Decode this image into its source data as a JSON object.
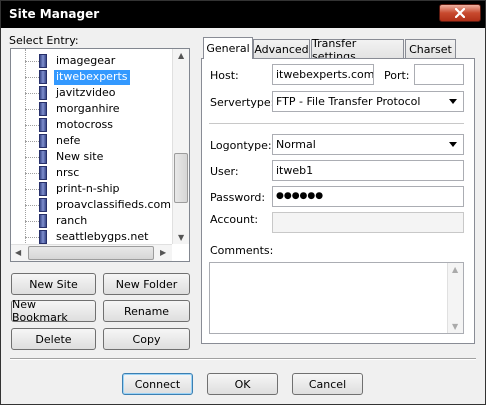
{
  "window": {
    "title": "Site Manager"
  },
  "left": {
    "select_entry_label": "Select Entry:",
    "entries": [
      {
        "label": "imagegear",
        "selected": false
      },
      {
        "label": "itwebexperts",
        "selected": true
      },
      {
        "label": "javitzvideo",
        "selected": false
      },
      {
        "label": "morganhire",
        "selected": false
      },
      {
        "label": "motocross",
        "selected": false
      },
      {
        "label": "nefe",
        "selected": false
      },
      {
        "label": "New site",
        "selected": false
      },
      {
        "label": "nrsc",
        "selected": false
      },
      {
        "label": "print-n-ship",
        "selected": false
      },
      {
        "label": "proavclassifieds.com",
        "selected": false
      },
      {
        "label": "ranch",
        "selected": false
      },
      {
        "label": "seattlebygps.net",
        "selected": false
      }
    ],
    "buttons": {
      "new_site": "New Site",
      "new_folder": "New Folder",
      "new_bookmark": "New Bookmark",
      "rename": "Rename",
      "delete": "Delete",
      "copy": "Copy"
    }
  },
  "tabs": [
    {
      "label": "General",
      "active": true
    },
    {
      "label": "Advanced",
      "active": false
    },
    {
      "label": "Transfer settings",
      "active": false
    },
    {
      "label": "Charset",
      "active": false
    }
  ],
  "general": {
    "host_label": "Host:",
    "host_value": "itwebexperts.com",
    "port_label": "Port:",
    "port_value": "",
    "servertype_label": "Servertype:",
    "servertype_value": "FTP - File Transfer Protocol",
    "logontype_label": "Logontype:",
    "logontype_value": "Normal",
    "user_label": "User:",
    "user_value": "itweb1",
    "password_label": "Password:",
    "password_value": "●●●●●●",
    "account_label": "Account:",
    "account_value": "",
    "comments_label": "Comments:",
    "comments_value": ""
  },
  "footer": {
    "connect": "Connect",
    "ok": "OK",
    "cancel": "Cancel"
  },
  "icons": {
    "close": "close-icon",
    "site": "server-icon"
  }
}
